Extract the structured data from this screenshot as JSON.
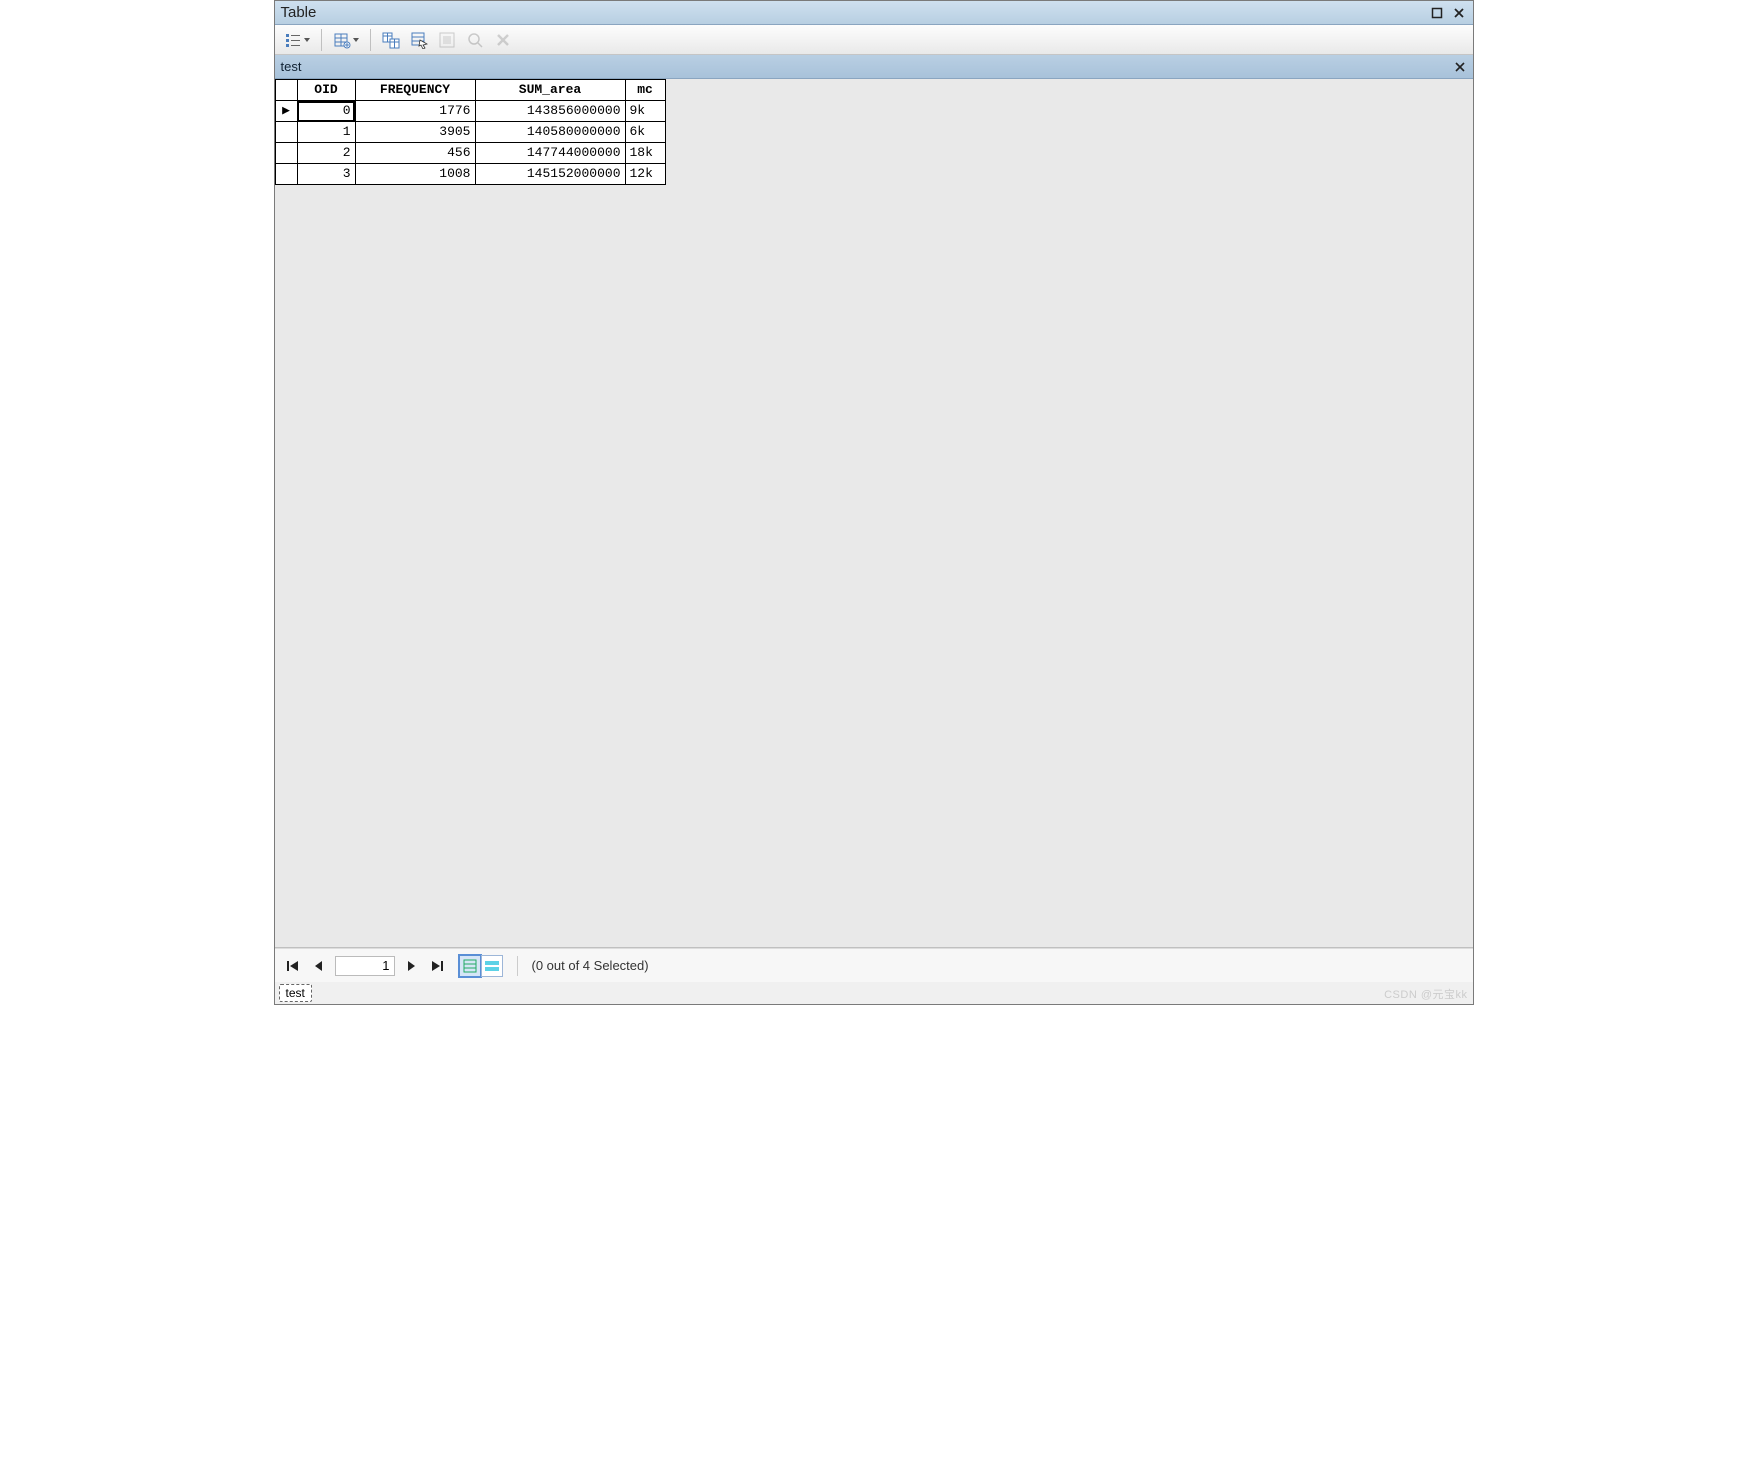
{
  "window": {
    "title": "Table"
  },
  "subheader": {
    "title": "test"
  },
  "columns": [
    "OID",
    "FREQUENCY",
    "SUM_area",
    "mc"
  ],
  "rows": [
    {
      "oid": "0",
      "frequency": "1776",
      "sum_area": "143856000000",
      "mc": "9k",
      "active": true
    },
    {
      "oid": "1",
      "frequency": "3905",
      "sum_area": "140580000000",
      "mc": "6k",
      "active": false
    },
    {
      "oid": "2",
      "frequency": "456",
      "sum_area": "147744000000",
      "mc": "18k",
      "active": false
    },
    {
      "oid": "3",
      "frequency": "1008",
      "sum_area": "145152000000",
      "mc": "12k",
      "active": false
    }
  ],
  "pager": {
    "current": "1",
    "selection_text": "(0 out of 4 Selected)"
  },
  "tabs": [
    {
      "label": "test"
    }
  ],
  "watermark": "CSDN @元宝kk"
}
